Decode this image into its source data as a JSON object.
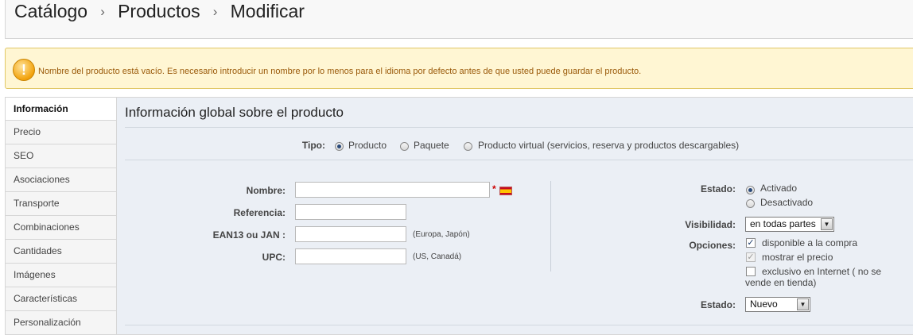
{
  "breadcrumb": {
    "items": [
      "Catálogo",
      "Productos",
      "Modificar"
    ],
    "separator": "›"
  },
  "warning": {
    "icon": "exclamation-icon",
    "message": "Nombre del producto está vacío. Es necesario introducir un nombre por lo menos para el idioma por defecto antes de que usted puede guardar el producto."
  },
  "tabs": [
    "Información",
    "Precio",
    "SEO",
    "Asociaciones",
    "Transporte",
    "Combinaciones",
    "Cantidades",
    "Imágenes",
    "Características",
    "Personalización"
  ],
  "active_tab": "Información",
  "section": {
    "title": "Información global sobre el producto",
    "tipo": {
      "label": "Tipo:",
      "options": [
        "Producto",
        "Paquete",
        "Producto virtual (servicios, reserva y productos descargables)"
      ],
      "selected": "Producto"
    }
  },
  "form": {
    "nombre": {
      "label": "Nombre:",
      "value": "",
      "required_mark": "*",
      "language_flag": "spain-flag-icon"
    },
    "referencia": {
      "label": "Referencia:",
      "value": ""
    },
    "ean13": {
      "label": "EAN13 ou JAN :",
      "value": "",
      "hint": "(Europa, Japón)"
    },
    "upc": {
      "label": "UPC:",
      "value": "",
      "hint": "(US, Canadá)"
    },
    "estado_activo": {
      "label": "Estado:",
      "options": [
        "Activado",
        "Desactivado"
      ],
      "selected": "Activado"
    },
    "visibilidad": {
      "label": "Visibilidad:",
      "value": "en todas partes"
    },
    "opciones": {
      "label": "Opciones:",
      "disponible": {
        "label": "disponible a la compra",
        "checked": true
      },
      "mostrar_precio": {
        "label": "mostrar el precio",
        "checked": true,
        "disabled": true
      },
      "exclusivo_line1": "exclusivo en Internet ( no se",
      "exclusivo_line2": "vende en tienda)",
      "exclusivo_checked": false
    },
    "condicion": {
      "label": "Estado:",
      "value": "Nuevo"
    }
  },
  "colors": {
    "warning_bg": "#fff6d3",
    "warning_text": "#9a5a0a",
    "panel_bg": "#ebeff5"
  }
}
